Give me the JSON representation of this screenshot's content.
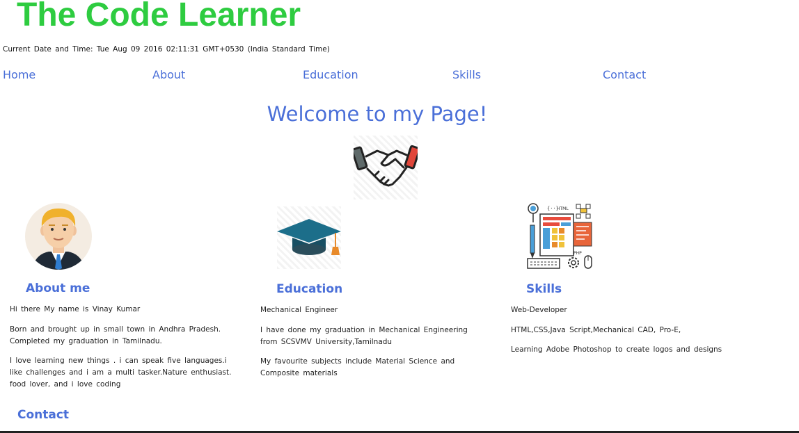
{
  "header": {
    "logo": "The Code Learner",
    "datetime": "Current Date and Time: Tue Aug 09 2016 02:11:31 GMT+0530 (India Standard Time)"
  },
  "nav": {
    "items": [
      {
        "label": "Home"
      },
      {
        "label": "About"
      },
      {
        "label": "Education"
      },
      {
        "label": "Skills"
      },
      {
        "label": "Contact"
      }
    ]
  },
  "main": {
    "welcome": "Welcome to my Page!",
    "about": {
      "title": "About me",
      "paragraphs": [
        "Hi there My name is Vinay Kumar",
        "Born and brought up in small town in Andhra Pradesh. Completed my graduation in Tamilnadu.",
        "I love learning new things . i can speak five languages.i like challenges and i am a multi tasker.Nature enthusiast. food lover, and i love coding"
      ]
    },
    "education": {
      "title": "Education",
      "paragraphs": [
        "Mechanical Engineer",
        "I have done my graduation in Mechanical Engineering from SCSVMV University,Tamilnadu",
        "My favourite subjects include Material Science and Composite materials"
      ]
    },
    "skills": {
      "title": "Skills",
      "paragraphs": [
        "Web-Developer",
        "HTML,CSS,Java Script,Mechanical CAD, Pro-E,",
        "Learning Adobe Photoshop to create logos and designs"
      ],
      "icon_labels": [
        "HTML",
        "PHP"
      ]
    },
    "contact": {
      "title": "Contact"
    }
  },
  "colors": {
    "logo": "#2ecc40",
    "link": "#4a6fd8",
    "text": "#222222"
  },
  "icons": [
    "handshake-icon",
    "avatar-icon",
    "graduation-cap-icon",
    "web-development-icon"
  ]
}
